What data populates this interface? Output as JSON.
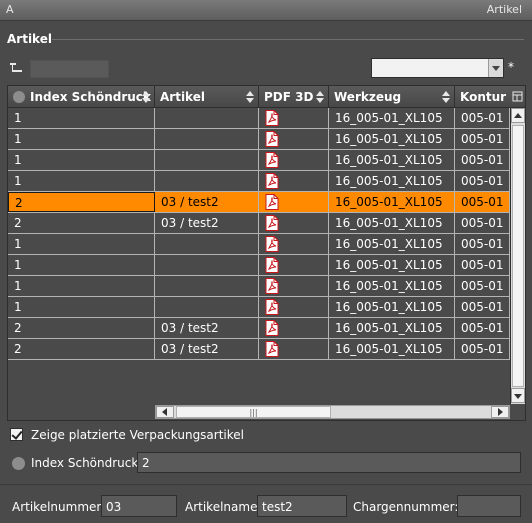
{
  "window": {
    "title_left": "A",
    "title_right": "Artikel"
  },
  "section": {
    "title": "Artikel"
  },
  "filter": {
    "value": "",
    "placeholder": ""
  },
  "combo": {
    "selected": ""
  },
  "asterisk": "*",
  "table": {
    "columns": [
      "Index Schöndruck",
      "Artikel",
      "PDF 3D",
      "Werkzeug",
      "Kontur"
    ],
    "rows": [
      [
        "1",
        "",
        "pdf",
        "16_005-01_XL105",
        "005-01"
      ],
      [
        "1",
        "",
        "pdf",
        "16_005-01_XL105",
        "005-01"
      ],
      [
        "1",
        "",
        "pdf",
        "16_005-01_XL105",
        "005-01"
      ],
      [
        "1",
        "",
        "pdf",
        "16_005-01_XL105",
        "005-01"
      ],
      [
        "2",
        "03 / test2",
        "pdf",
        "16_005-01_XL105",
        "005-01"
      ],
      [
        "2",
        "03 / test2",
        "pdf",
        "16_005-01_XL105",
        "005-01"
      ],
      [
        "1",
        "",
        "pdf",
        "16_005-01_XL105",
        "005-01"
      ],
      [
        "1",
        "",
        "pdf",
        "16_005-01_XL105",
        "005-01"
      ],
      [
        "1",
        "",
        "pdf",
        "16_005-01_XL105",
        "005-01"
      ],
      [
        "1",
        "",
        "pdf",
        "16_005-01_XL105",
        "005-01"
      ],
      [
        "2",
        "03 / test2",
        "pdf",
        "16_005-01_XL105",
        "005-01"
      ],
      [
        "2",
        "03 / test2",
        "pdf",
        "16_005-01_XL105",
        "005-01"
      ]
    ],
    "selected_row": 4,
    "selection_color": "#ff8a00",
    "hscroll_grip": "|||"
  },
  "options": {
    "show_placed_label": "Zeige platzierte Verpackungsartikel",
    "show_placed_checked": true,
    "index_label": "Index Schöndruck:",
    "index_value": "2"
  },
  "footer": {
    "artikelnummer_label": "Artikelnummer:",
    "artikelnummer_value": "03",
    "artikelname_label": "Artikelname:",
    "artikelname_value": "test2",
    "chargennummer_label": "Chargennummer:",
    "chargennummer_value": ""
  },
  "colors": {
    "background": "#4a4a4a",
    "accent": "#ff8a00",
    "pdf_icon": "#c8181e"
  }
}
